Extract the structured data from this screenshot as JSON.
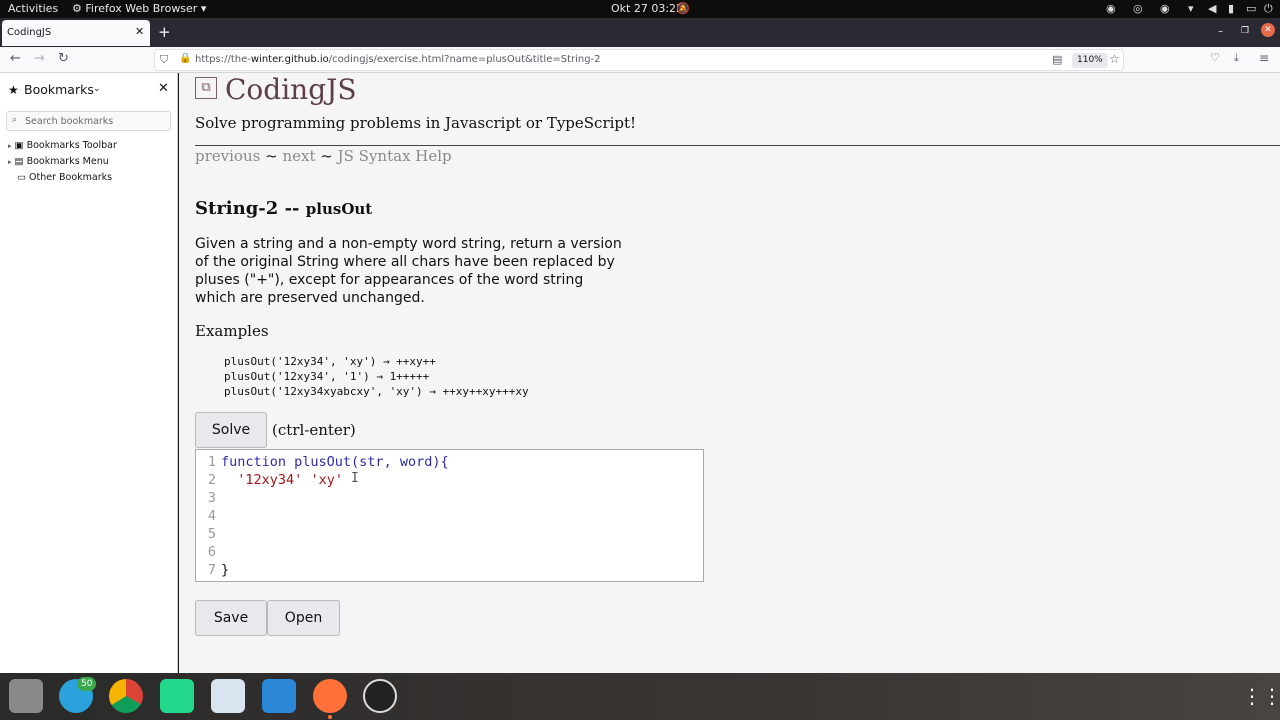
{
  "system": {
    "activities": "Activities",
    "app_name": "Firefox Web Browser",
    "datetime": "Okt 27  03:22"
  },
  "browser": {
    "tab_title": "CodingJS",
    "url_prefix": "https://the-",
    "url_host": "winter.github.io",
    "url_path": "/codingjs/exercise.html?name=plusOut&title=String-2",
    "zoom": "110%"
  },
  "sidebar": {
    "title": "Bookmarks",
    "search_placeholder": "Search bookmarks",
    "items": [
      {
        "label": "Bookmarks Toolbar"
      },
      {
        "label": "Bookmarks Menu"
      },
      {
        "label": "Other Bookmarks"
      }
    ]
  },
  "page": {
    "site_title": "CodingJS",
    "tagline": "Solve programming problems in Javascript or TypeScript!",
    "nav": {
      "previous": "previous",
      "sep": "~",
      "next": "next",
      "help": "JS Syntax Help"
    },
    "heading_main": "String-2 --",
    "heading_sub": "plusOut",
    "description": "Given a string and a non-empty word string, return a version of the original String where all chars have been replaced by pluses (\"+\"), except for appearances of the word string which are preserved unchanged.",
    "examples_label": "Examples",
    "examples": [
      "plusOut('12xy34', 'xy') → ++xy++",
      "plusOut('12xy34', '1') → 1+++++",
      "plusOut('12xy34xyabcxy', 'xy') → ++xy++xy+++xy"
    ],
    "solve_label": "Solve",
    "solve_hint": "(ctrl-enter)",
    "save_label": "Save",
    "open_label": "Open"
  },
  "editor": {
    "line_numbers": [
      "1",
      "2",
      "3",
      "4",
      "5",
      "6",
      "7"
    ],
    "line1_kw": "function",
    "line1_rest": " plusOut(str, word){",
    "line2_str1": "'12xy34'",
    "line2_str2": "'xy'",
    "line7": "}"
  },
  "taskbar": {
    "badge": "50"
  }
}
